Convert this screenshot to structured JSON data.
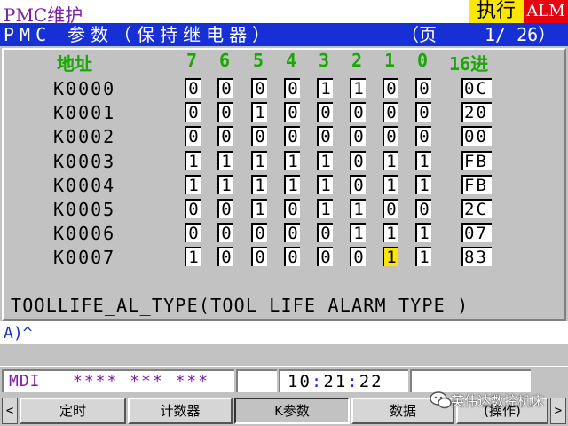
{
  "title": "PMC维护",
  "badges": {
    "exec": "执行",
    "alarm": "ALM"
  },
  "header": {
    "screen_name": "PMC 参数（保持继电器）",
    "page_label": "（页",
    "page_value": "1/ 26）"
  },
  "columns": {
    "address": "地址",
    "bits": [
      "7",
      "6",
      "5",
      "4",
      "3",
      "2",
      "1",
      "0"
    ],
    "hex": "16进"
  },
  "rows": [
    {
      "addr": "K0000",
      "bits": [
        "0",
        "0",
        "0",
        "0",
        "1",
        "1",
        "0",
        "0"
      ],
      "hex": "0C"
    },
    {
      "addr": "K0001",
      "bits": [
        "0",
        "0",
        "1",
        "0",
        "0",
        "0",
        "0",
        "0"
      ],
      "hex": "20"
    },
    {
      "addr": "K0002",
      "bits": [
        "0",
        "0",
        "0",
        "0",
        "0",
        "0",
        "0",
        "0"
      ],
      "hex": "00"
    },
    {
      "addr": "K0003",
      "bits": [
        "1",
        "1",
        "1",
        "1",
        "1",
        "0",
        "1",
        "1"
      ],
      "hex": "FB"
    },
    {
      "addr": "K0004",
      "bits": [
        "1",
        "1",
        "1",
        "1",
        "1",
        "0",
        "1",
        "1"
      ],
      "hex": "FB"
    },
    {
      "addr": "K0005",
      "bits": [
        "0",
        "0",
        "1",
        "0",
        "1",
        "1",
        "0",
        "0"
      ],
      "hex": "2C"
    },
    {
      "addr": "K0006",
      "bits": [
        "0",
        "0",
        "0",
        "0",
        "0",
        "1",
        "1",
        "1"
      ],
      "hex": "07"
    },
    {
      "addr": "K0007",
      "bits": [
        "1",
        "0",
        "0",
        "0",
        "0",
        "0",
        "1",
        "1"
      ],
      "hex": "83"
    }
  ],
  "selected": {
    "row": 7,
    "bit": 6
  },
  "description": "TOOLLIFE_AL_TYPE(TOOL LIFE ALARM TYPE )",
  "input_line": "A)^",
  "status": {
    "mode": "MDI",
    "stars": "**** *** ***",
    "time": "10:21:22"
  },
  "softkeys": [
    "定时",
    "计数器",
    "K参数",
    "数据",
    "(操作)"
  ],
  "active_softkey": 2,
  "watermark": "英伟达数控机床",
  "colors": {
    "title": "#7a1fa2",
    "header_bg": "#1630d6",
    "column_header": "#18a800",
    "exec_bg": "#ffe600",
    "alarm_bg": "#e60012",
    "status_text": "#7a1fa2",
    "time_colon": "#1630d6"
  }
}
